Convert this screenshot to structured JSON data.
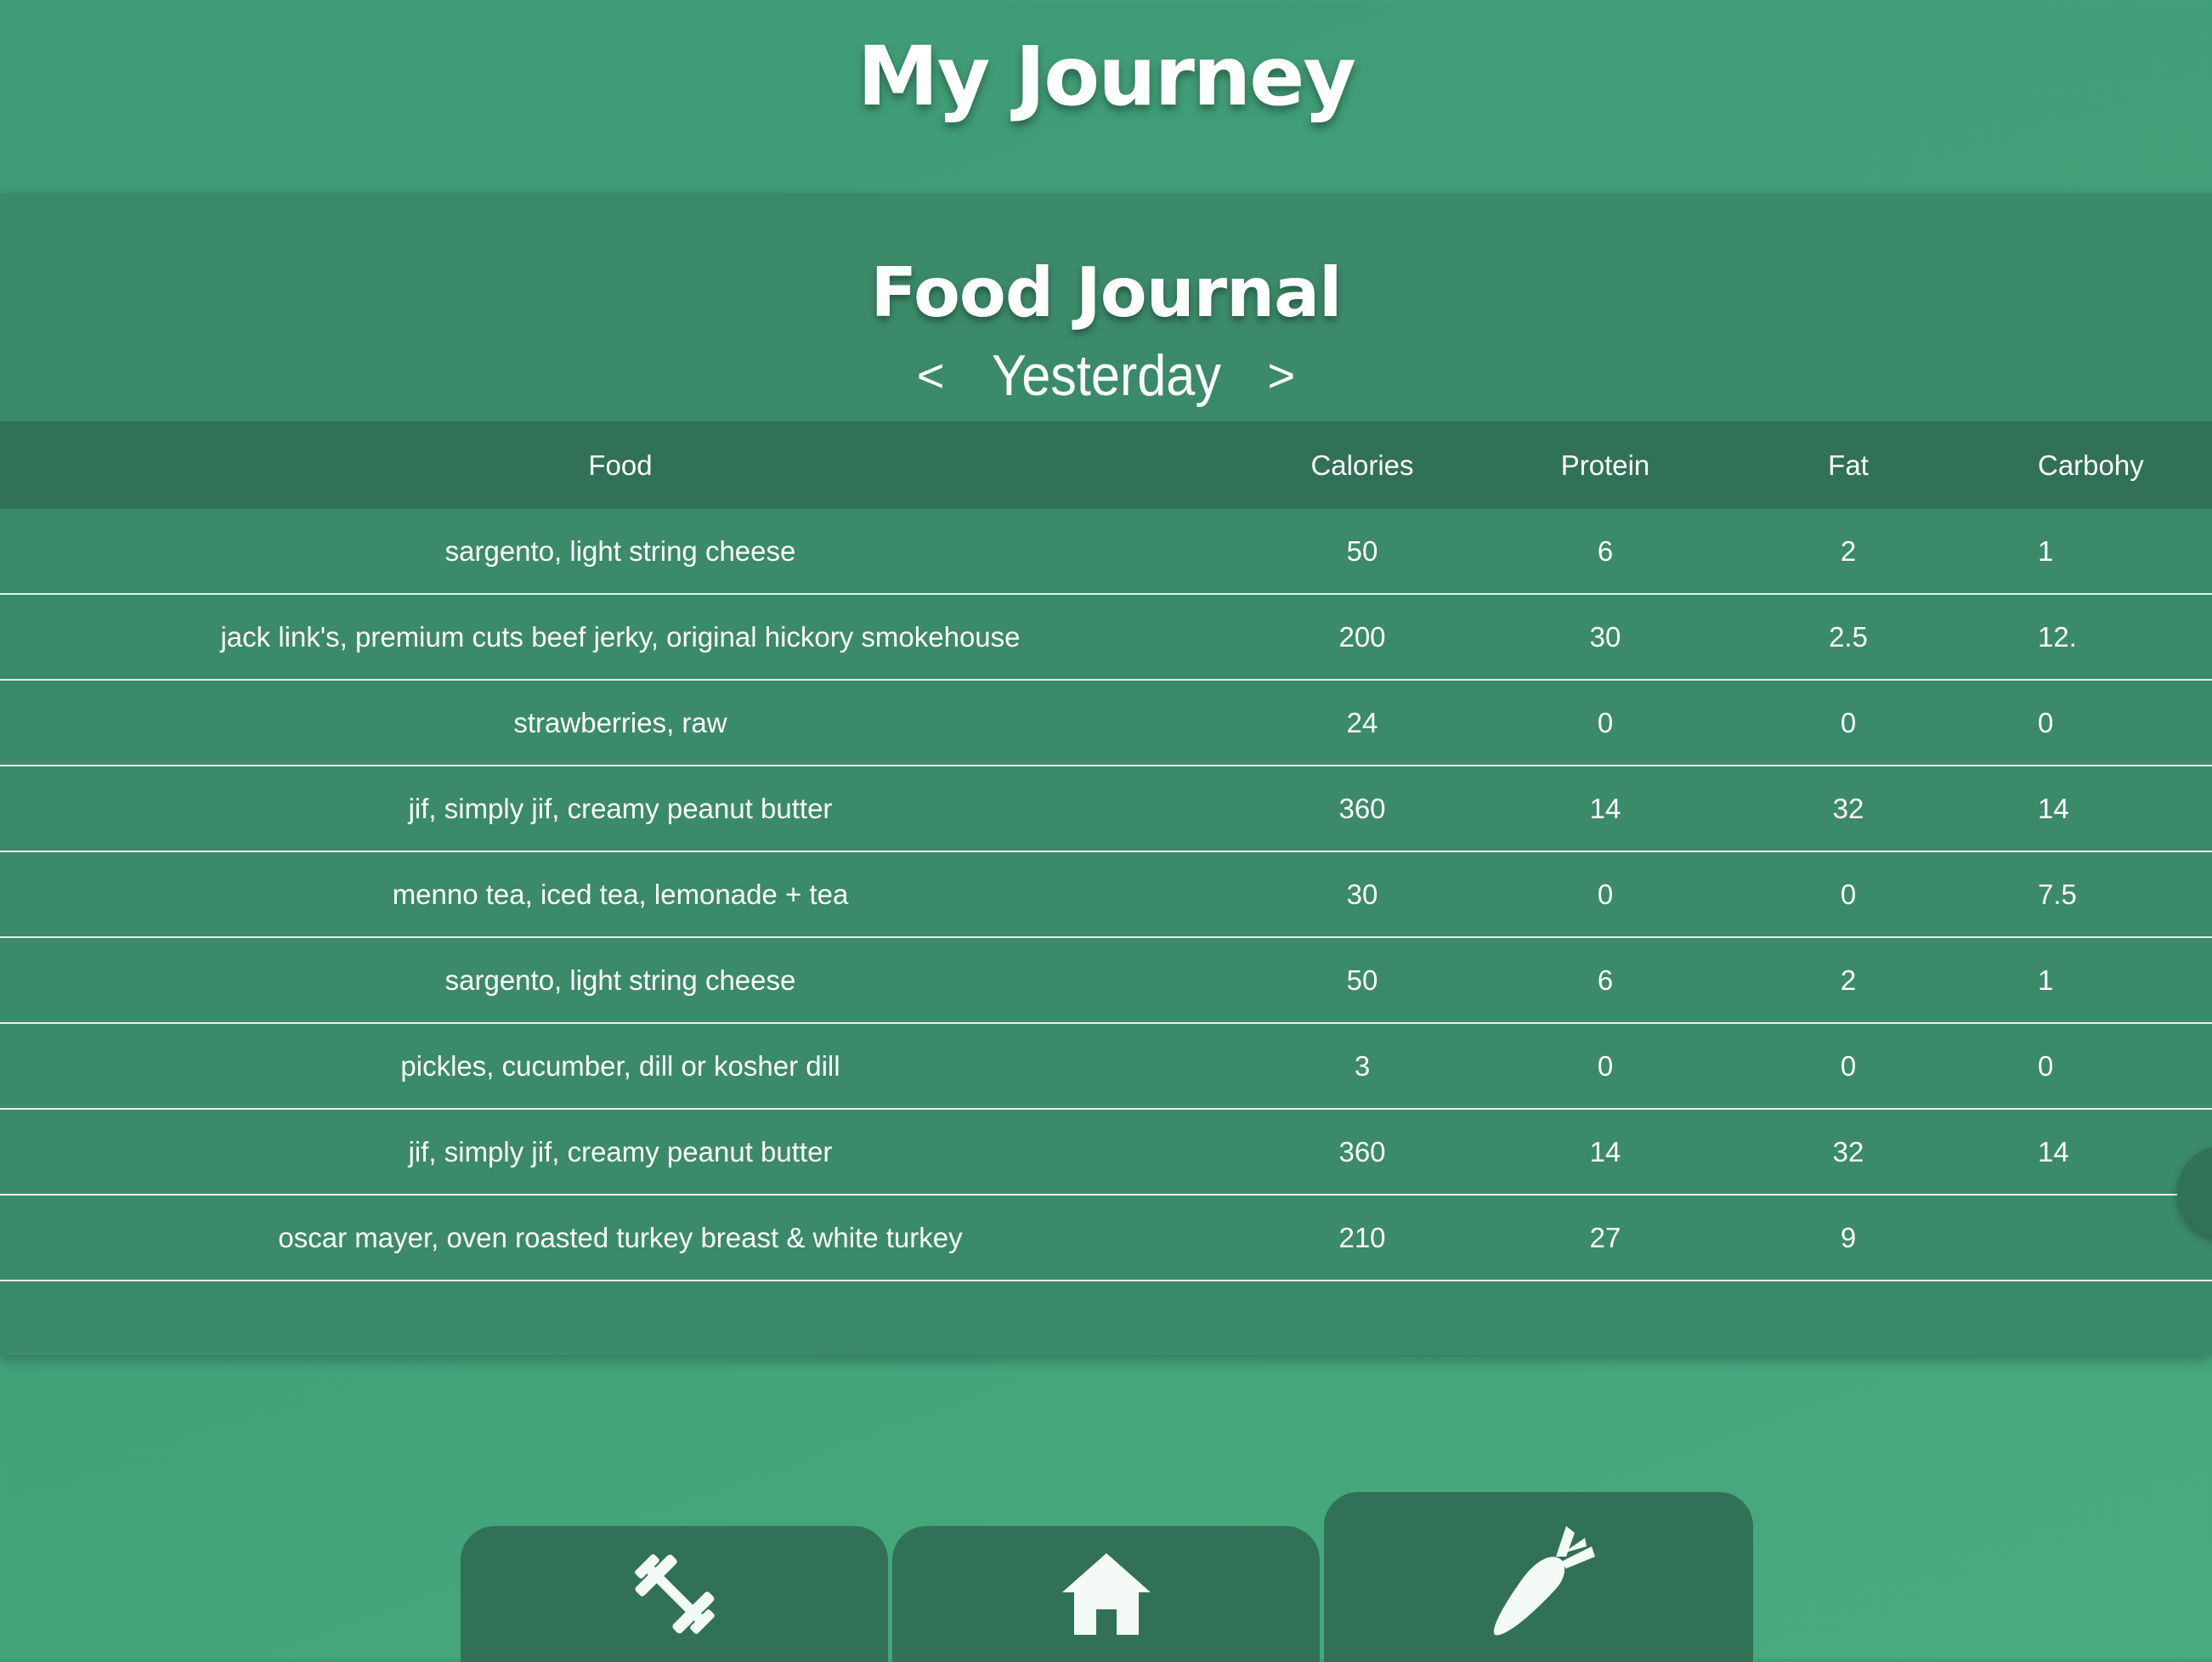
{
  "header": {
    "title": "My Journey"
  },
  "journal": {
    "title": "Food Journal",
    "prev_label": "<",
    "day_label": "Yesterday",
    "next_label": ">"
  },
  "table": {
    "columns": [
      "Food",
      "Calories",
      "Protein",
      "Fat",
      "Carbohy"
    ],
    "rows": [
      [
        "sargento, light string cheese",
        "50",
        "6",
        "2",
        "1"
      ],
      [
        "jack link's, premium cuts beef jerky, original hickory smokehouse",
        "200",
        "30",
        "2.5",
        "12."
      ],
      [
        "strawberries, raw",
        "24",
        "0",
        "0",
        "0"
      ],
      [
        "jif, simply jif, creamy peanut butter",
        "360",
        "14",
        "32",
        "14"
      ],
      [
        "menno tea, iced tea, lemonade + tea",
        "30",
        "0",
        "0",
        "7.5"
      ],
      [
        "sargento, light string cheese",
        "50",
        "6",
        "2",
        "1"
      ],
      [
        "pickles, cucumber, dill or kosher dill",
        "3",
        "0",
        "0",
        "0"
      ],
      [
        "jif, simply jif, creamy peanut butter",
        "360",
        "14",
        "32",
        "14"
      ],
      [
        "oscar mayer, oven roasted turkey breast & white turkey",
        "210",
        "27",
        "9",
        ""
      ]
    ]
  },
  "bottom_nav": {
    "tabs": [
      {
        "icon": "dumbbell-icon",
        "active": false
      },
      {
        "icon": "home-icon",
        "active": false
      },
      {
        "icon": "carrot-icon",
        "active": true
      }
    ]
  },
  "colors": {
    "background": "#43a179",
    "panel": "#3b8a6a",
    "header_row": "#317158",
    "nav_tab": "#317158",
    "text": "#ffffff"
  }
}
